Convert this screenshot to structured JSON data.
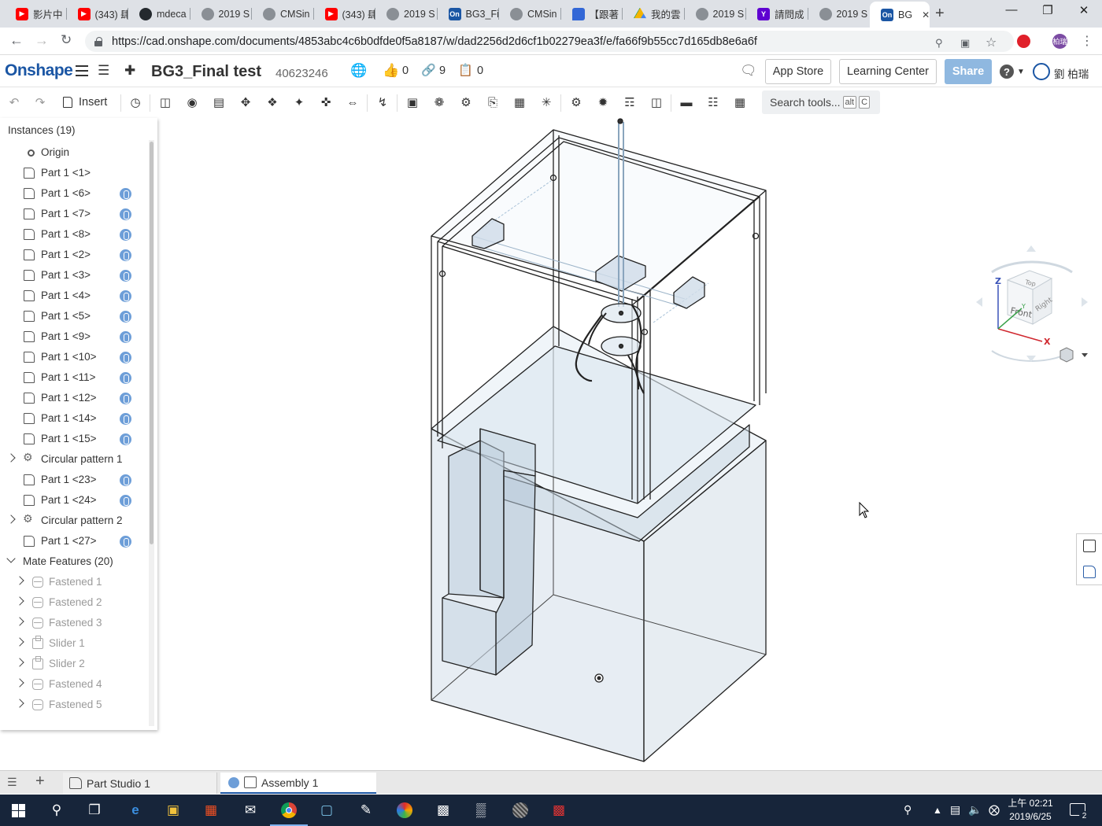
{
  "browser": {
    "tabs": [
      {
        "title": "影片中",
        "icon": "youtube-icon"
      },
      {
        "title": "(343) 肆",
        "icon": "youtube-icon"
      },
      {
        "title": "mdeca",
        "icon": "github-icon"
      },
      {
        "title": "2019 S",
        "icon": "globe-icon"
      },
      {
        "title": "CMSin",
        "icon": "globe-icon"
      },
      {
        "title": "(343) 肆",
        "icon": "youtube-icon"
      },
      {
        "title": "2019 S",
        "icon": "globe-icon"
      },
      {
        "title": "BG3_Fi",
        "icon": "onshape-icon"
      },
      {
        "title": "CMSin",
        "icon": "globe-icon"
      },
      {
        "title": "【跟著",
        "icon": "chat-icon"
      },
      {
        "title": "我的雲",
        "icon": "drive-icon"
      },
      {
        "title": "2019 S",
        "icon": "globe-icon"
      },
      {
        "title": "請問成",
        "icon": "yahoo-icon"
      },
      {
        "title": "2019 S",
        "icon": "globe-icon"
      },
      {
        "title": "BG",
        "icon": "onshape-icon",
        "active": true
      }
    ],
    "url": "https://cad.onshape.com/documents/4853abc4c6b0dfde0f5a8187/w/dad2256d2d6cf1b02279ea3f/e/fa66f9b55cc7d165db8e6a6f",
    "profile_initials": "柏瑞"
  },
  "header": {
    "logo": "Onshape",
    "doc_title": "BG3_Final test",
    "doc_id": "40623246",
    "likes": "0",
    "links": "9",
    "copies": "0",
    "app_store": "App Store",
    "learning_center": "Learning Center",
    "share": "Share",
    "user": "劉 柏瑞"
  },
  "toolbar": {
    "insert": "Insert",
    "search_placeholder": "Search tools...",
    "search_kbd1": "alt",
    "search_kbd2": "C"
  },
  "instances": {
    "title": "Instances (19)",
    "items": [
      {
        "label": "Origin",
        "type": "origin"
      },
      {
        "label": "Part 1 <1>",
        "type": "part",
        "mate": false
      },
      {
        "label": "Part 1 <6>",
        "type": "part",
        "mate": true
      },
      {
        "label": "Part 1 <7>",
        "type": "part",
        "mate": true
      },
      {
        "label": "Part 1 <8>",
        "type": "part",
        "mate": true
      },
      {
        "label": "Part 1 <2>",
        "type": "part",
        "mate": true
      },
      {
        "label": "Part 1 <3>",
        "type": "part",
        "mate": true
      },
      {
        "label": "Part 1 <4>",
        "type": "part",
        "mate": true
      },
      {
        "label": "Part 1 <5>",
        "type": "part",
        "mate": true
      },
      {
        "label": "Part 1 <9>",
        "type": "part",
        "mate": true
      },
      {
        "label": "Part 1 <10>",
        "type": "part",
        "mate": true
      },
      {
        "label": "Part 1 <11>",
        "type": "part",
        "mate": true
      },
      {
        "label": "Part 1 <12>",
        "type": "part",
        "mate": true
      },
      {
        "label": "Part 1 <14>",
        "type": "part",
        "mate": true
      },
      {
        "label": "Part 1 <15>",
        "type": "part",
        "mate": true
      },
      {
        "label": "Circular pattern 1",
        "type": "pattern"
      },
      {
        "label": "Part 1 <23>",
        "type": "part",
        "mate": true
      },
      {
        "label": "Part 1 <24>",
        "type": "part",
        "mate": true
      },
      {
        "label": "Circular pattern 2",
        "type": "pattern"
      },
      {
        "label": "Part 1 <27>",
        "type": "part",
        "mate": true
      }
    ]
  },
  "mate_features": {
    "title": "Mate Features (20)",
    "items": [
      {
        "label": "Fastened 1",
        "type": "mate"
      },
      {
        "label": "Fastened 2",
        "type": "mate"
      },
      {
        "label": "Fastened 3",
        "type": "mate"
      },
      {
        "label": "Slider 1",
        "type": "slider"
      },
      {
        "label": "Slider 2",
        "type": "slider"
      },
      {
        "label": "Fastened 4",
        "type": "mate"
      },
      {
        "label": "Fastened 5",
        "type": "mate"
      }
    ]
  },
  "viewcube": {
    "top": "Top",
    "front": "Front",
    "right": "Right",
    "z": "Z",
    "x": "X",
    "y": "Y"
  },
  "bottom_tabs": {
    "part_studio": "Part Studio 1",
    "assembly": "Assembly 1"
  },
  "taskbar": {
    "time": "上午 02:21",
    "date": "2019/6/25",
    "notifications": "2"
  }
}
